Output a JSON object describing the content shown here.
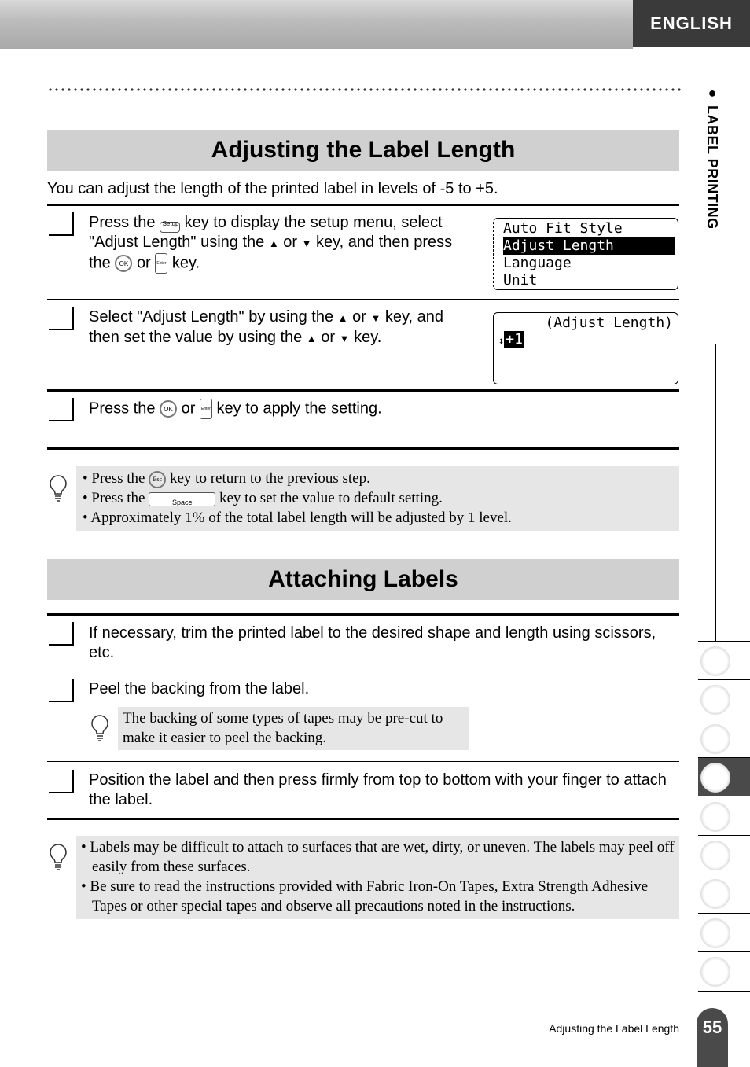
{
  "header": {
    "language": "ENGLISH"
  },
  "side": {
    "chapter": "LABEL PRINTING",
    "tabs": 9,
    "active_tab": 4
  },
  "section1": {
    "title": "Adjusting the Label Length",
    "intro": "You can adjust the length of the printed label in levels of -5 to +5.",
    "step1": {
      "a": "Press the",
      "key_setup": "Setup",
      "b": "key to display the setup menu, select",
      "c": "\"Adjust Length\" using the",
      "or": "or",
      "d": "key, and then press",
      "e": "the",
      "f": "key."
    },
    "lcd1": {
      "items": [
        "Auto Fit Style",
        "Adjust Length",
        "Language",
        "Unit"
      ],
      "selected": 1
    },
    "step2": {
      "a": "Select \"Adjust Length\" by using the",
      "or": "or",
      "b": "key, and",
      "c": "then set the value by using the",
      "d": "key."
    },
    "lcd2": {
      "title": "(Adjust Length)",
      "value": "+1"
    },
    "step3": {
      "a": "Press the",
      "or": "or",
      "b": "key to apply the setting."
    },
    "notes": {
      "n1a": "Press the",
      "n1key": "Esc",
      "n1b": "key to return to the previous step.",
      "n2a": "Press the",
      "n2key": "Space",
      "n2b": "key to set the value to default setting.",
      "n3": "Approximately 1% of the total label length will be adjusted by 1 level."
    }
  },
  "section2": {
    "title": "Attaching Labels",
    "step1": "If necessary, trim the printed label to the desired shape and length using scissors, etc.",
    "step2": "Peel the backing from the label.",
    "step2note": "The backing of some types of tapes may be pre-cut to make it easier to peel the backing.",
    "step3": "Position the label and then press firmly from top to bottom with your finger to attach the label.",
    "notes": [
      "Labels may be difficult to attach to surfaces that are wet, dirty, or uneven.  The labels may peel off easily from these surfaces.",
      "Be sure to read the instructions provided with Fabric Iron-On Tapes, Extra Strength Adhesive Tapes or other special tapes and observe all precautions noted in the instructions."
    ]
  },
  "footer": {
    "title": "Adjusting the Label Length",
    "page": "55"
  },
  "keys": {
    "ok": "OK",
    "enter": "Enter"
  }
}
